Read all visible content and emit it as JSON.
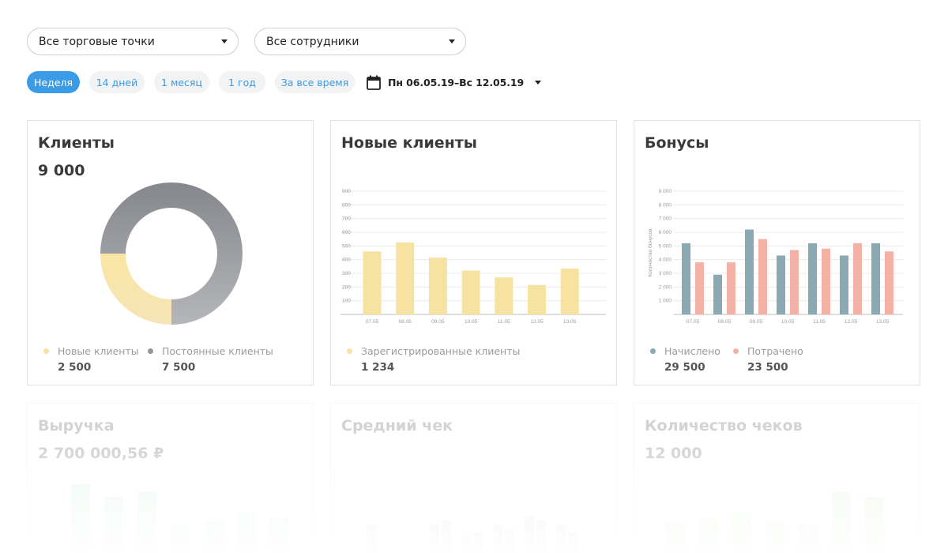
{
  "filters": {
    "outlets": {
      "selected": "Все торговые точки"
    },
    "employees": {
      "selected": "Все сотрудники"
    }
  },
  "period": {
    "chips": [
      {
        "label": "Неделя",
        "active": true
      },
      {
        "label": "14 дней",
        "active": false
      },
      {
        "label": "1 месяц",
        "active": false
      },
      {
        "label": "1 год",
        "active": false
      },
      {
        "label": "За все время",
        "active": false
      }
    ],
    "date_range": "Пн 06.05.19–Вс 12.05.19",
    "calendar_icon": "calendar-icon"
  },
  "cards": {
    "clients": {
      "title": "Клиенты",
      "total": "9 000",
      "legend": [
        {
          "label": "Новые клиенты",
          "value": "2 500",
          "color": "#f6e3a1"
        },
        {
          "label": "Постоянные клиенты",
          "value": "7 500",
          "color": "#93959a"
        }
      ]
    },
    "new_clients": {
      "title": "Новые клиенты",
      "legend": [
        {
          "label": "Зарегистрированные клиенты",
          "value": "1 234",
          "color": "#f6e3a1"
        }
      ]
    },
    "bonuses": {
      "title": "Бонусы",
      "legend": [
        {
          "label": "Начислено",
          "value": "29 500",
          "color": "#8aa9b3"
        },
        {
          "label": "Потрачено",
          "value": "23 500",
          "color": "#f3b0a4"
        }
      ]
    },
    "revenue": {
      "title": "Выручка",
      "total": "2 700 000,56 ₽"
    },
    "avg_check": {
      "title": "Средний чек"
    },
    "check_count": {
      "title": "Количество чеков",
      "total": "12 000"
    }
  },
  "chart_data": [
    {
      "type": "pie",
      "categories": [
        "Новые клиенты",
        "Постоянные клиенты"
      ],
      "values": [
        2500,
        7500
      ],
      "colors": [
        "#f6e3a1",
        "#93959a"
      ]
    },
    {
      "type": "bar",
      "categories": [
        "07.05",
        "08.05",
        "09.05",
        "10.05",
        "11.05",
        "12.05",
        "13.05"
      ],
      "series": [
        {
          "name": "Зарегистрированные клиенты",
          "values": [
            460,
            525,
            415,
            320,
            270,
            215,
            335
          ]
        }
      ],
      "yticks": [
        "100",
        "200",
        "300",
        "400",
        "500",
        "600",
        "700",
        "800",
        "900"
      ],
      "ylim": [
        0,
        900
      ],
      "grid": true,
      "colors": [
        "#f6e3a1"
      ]
    },
    {
      "type": "bar",
      "categories": [
        "07.05",
        "08.05",
        "09.05",
        "10.05",
        "11.05",
        "12.05",
        "13.05"
      ],
      "series": [
        {
          "name": "Начислено",
          "values": [
            5200,
            2900,
            6200,
            4300,
            5200,
            4300,
            5200
          ]
        },
        {
          "name": "Потрачено",
          "values": [
            3800,
            3800,
            5500,
            4700,
            4800,
            5200,
            4600
          ]
        }
      ],
      "yticks": [
        "1 000",
        "2 000",
        "3 000",
        "4 000",
        "5 000",
        "6 000",
        "7 000",
        "8 000",
        "9 000"
      ],
      "ylim": [
        0,
        9000
      ],
      "ylabel": "Количество бонусов",
      "grid": true,
      "colors": [
        "#8aa9b3",
        "#f3b0a4"
      ]
    }
  ]
}
